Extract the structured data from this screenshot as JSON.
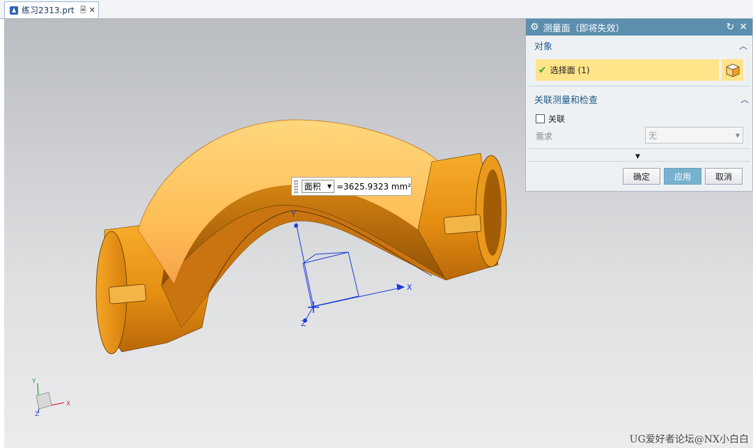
{
  "tab": {
    "title": "练习2313.prt",
    "icon": "nx-part-file-icon"
  },
  "viewport": {
    "triad_labels": {
      "x": "X",
      "y": "Y",
      "z": "Z"
    },
    "csys_labels": {
      "x": "X",
      "y": "Y",
      "z": "Z"
    }
  },
  "measure": {
    "type_options": [
      "面积"
    ],
    "type_selected": "面积",
    "value": "=3625.9323 mm²"
  },
  "panel": {
    "title": "测量面（即将失效）",
    "object_section": {
      "label": "对象",
      "select_label": "选择面 (1)"
    },
    "assoc_section": {
      "label": "关联测量和检查",
      "assoc_checkbox_label": "关联",
      "assoc_checked": false,
      "req_label": "需求",
      "req_value": "无"
    },
    "buttons": {
      "ok": "确定",
      "apply": "应用",
      "cancel": "取消"
    }
  },
  "watermark": "UG爱好者论坛@NX小白白",
  "colors": {
    "title_bar": "#5b8fad",
    "selection_highlight": "#ffe48a",
    "part_orange": "#f0a020",
    "selected_face": "#ffc25a",
    "csys_blue": "#1a3ad8"
  }
}
